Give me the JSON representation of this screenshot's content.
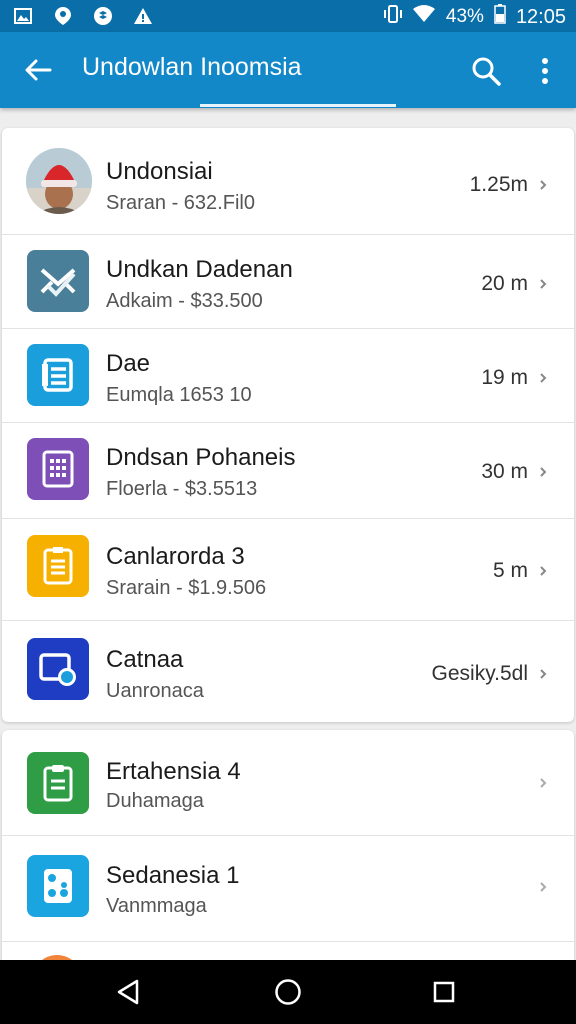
{
  "status_bar": {
    "battery": "43%",
    "time": "12:05",
    "left_icons": [
      "gallery-icon",
      "location-icon",
      "dropbox-icon",
      "alert-icon"
    ],
    "right_icons": [
      "vibrate-icon",
      "wifi-icon",
      "battery-icon"
    ]
  },
  "appbar": {
    "title": "Undowlan Inoomsia",
    "back_icon": "arrow-back-icon",
    "search_icon": "search-icon",
    "menu_icon": "more-vert-icon",
    "color": "#1388c8"
  },
  "list1": [
    {
      "name": "Undonsiai",
      "sub": "Sraran - 632.Fil0",
      "size": "1.25m",
      "icon": "avatar"
    },
    {
      "name": "Undkan Dadenan",
      "sub": "Adkaim - $33.500",
      "size": "20 m",
      "icon": "check-mail-icon",
      "color": "#4a7f9a"
    },
    {
      "name": "Dae",
      "sub": "Eumqla 1653 10",
      "size": "19 m",
      "icon": "list-icon",
      "color": "#1a9fdc"
    },
    {
      "name": "Dndsan Pohaneis",
      "sub": "Floerla - $3.5513",
      "size": "30 m",
      "icon": "calendar-icon",
      "color": "#7e4fb6"
    },
    {
      "name": "Canlarorda  3",
      "sub": "Srarain - $1.9.506",
      "size": "5 m",
      "icon": "document-icon",
      "color": "#f5b000"
    },
    {
      "name": "Catnaa",
      "sub": "Uanronaca",
      "size": "Gesiky.5dl",
      "icon": "screen-record-icon",
      "color": "#1e3dc2"
    }
  ],
  "list2": [
    {
      "name": "Ertahensia  4",
      "sub": "Duhamaga",
      "icon": "clipboard-icon",
      "color": "#2e9d45"
    },
    {
      "name": "Sedanesia  1",
      "sub": "Vanmmaga",
      "icon": "dice-icon",
      "color": "#1aa5e0"
    }
  ],
  "navbar": {
    "back_icon": "nav-back-icon",
    "home_icon": "nav-home-icon",
    "recents_icon": "nav-recents-icon"
  }
}
